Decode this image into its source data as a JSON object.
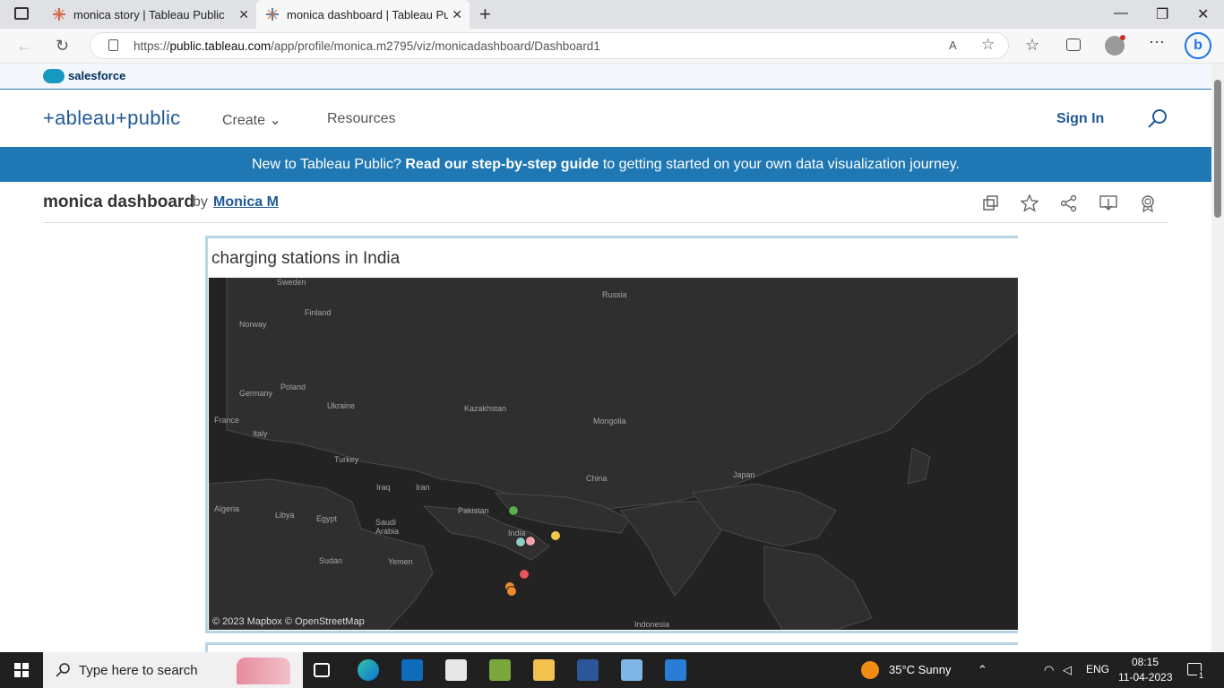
{
  "browser": {
    "tabs": [
      {
        "title": "monica story | Tableau Public",
        "close": "✕"
      },
      {
        "title": "monica dashboard | Tableau Publ",
        "close": "✕"
      }
    ],
    "new_tab": "+",
    "url_prefix": "https://",
    "url_host": "public.tableau.com",
    "url_path": "/app/profile/monica.m2795/viz/monicadashboard/Dashboard1",
    "window_controls": {
      "minimize": "—",
      "restore": "❐",
      "close": "✕"
    }
  },
  "salesforce": {
    "label": "salesforce"
  },
  "header": {
    "logo": "+ableau+public",
    "nav": [
      {
        "label": "Create ⌄"
      },
      {
        "label": "Resources"
      }
    ],
    "sign_in": "Sign In"
  },
  "banner": {
    "prefix": "New to Tableau Public? ",
    "link": "Read our step-by-step guide",
    "suffix": " to getting started on your own data visualization journey."
  },
  "viz": {
    "title": "monica dashboard",
    "by": "by",
    "author": "Monica M"
  },
  "dashboard": {
    "title": "charging stations in India",
    "attribution": "© 2023 Mapbox  © OpenStreetMap",
    "map_labels": [
      "Sweden",
      "Finland",
      "Norway",
      "Russia",
      "Germany",
      "Poland",
      "Ukraine",
      "France",
      "Italy",
      "Kazakhstan",
      "Mongolia",
      "Turkey",
      "Iraq",
      "Iran",
      "China",
      "Japan",
      "Algeria",
      "Libya",
      "Egypt",
      "Saudi Arabia",
      "Pakistan",
      "India",
      "Sudan",
      "Yemen",
      "Indonesia"
    ],
    "points_colors": [
      "#5bab4f",
      "#8fc9c2",
      "#f4a3a8",
      "#f2c84b",
      "#e8555b",
      "#ef8a2b",
      "#ef8a2b"
    ]
  },
  "taskbar": {
    "search_placeholder": "Type here to search",
    "weather": "35°C  Sunny",
    "lang": "ENG",
    "time": "08:15",
    "date": "11-04-2023",
    "notification_count": "1"
  }
}
